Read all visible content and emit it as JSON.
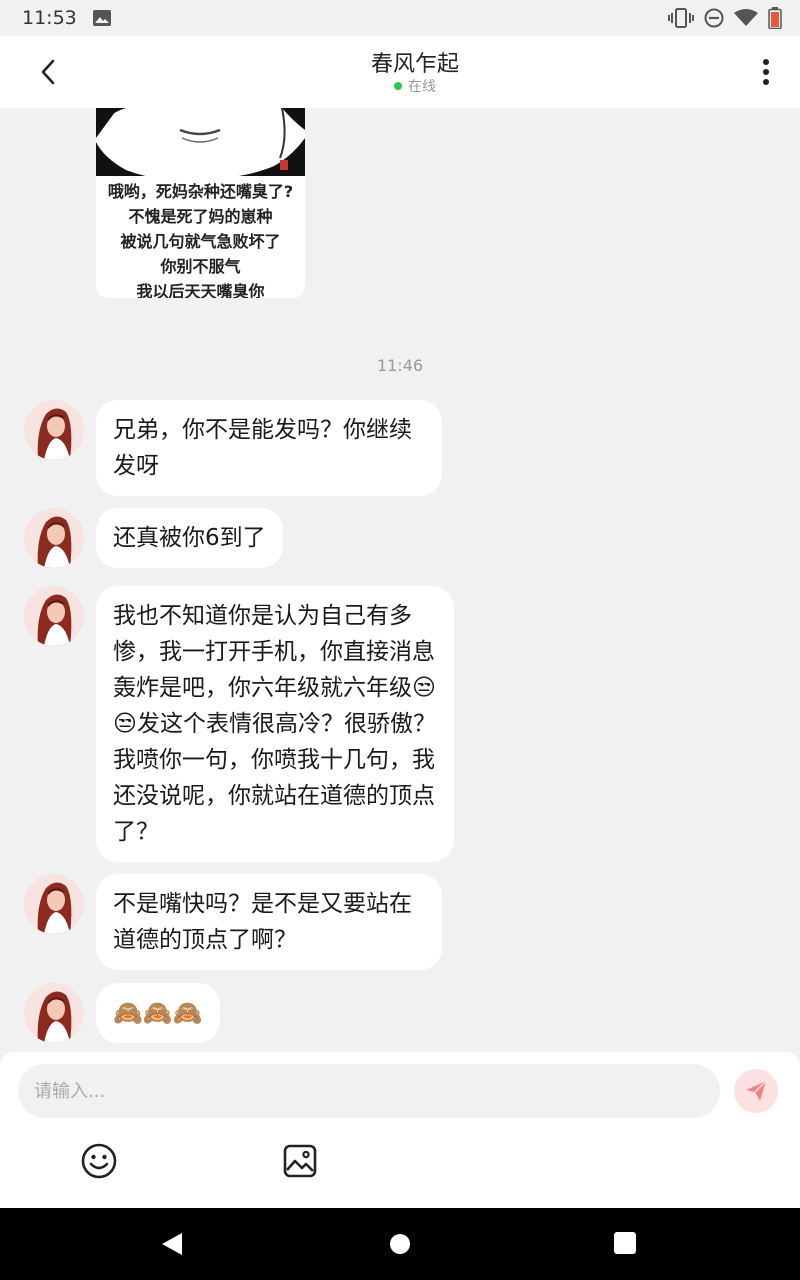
{
  "status_bar": {
    "time": "11:53",
    "icons": [
      "image-notification-icon",
      "vibrate-icon",
      "do-not-disturb-icon",
      "wifi-icon",
      "battery-icon"
    ]
  },
  "header": {
    "back_icon": "chevron-left-icon",
    "contact_name": "春风乍起",
    "presence": "在线",
    "presence_color": "#35c24a",
    "more_icon": "more-vertical-icon"
  },
  "meme": {
    "lines": [
      "哦哟，死妈杂种还嘴臭了?",
      "不愧是死了妈的崽种",
      "被说几句就气急败坏了",
      "你别不服气",
      "我以后天天嘴臭你"
    ]
  },
  "timestamp": "11:46",
  "messages": [
    {
      "text": "兄弟，你不是能发吗？你继续发呀"
    },
    {
      "text": "还真被你6到了"
    },
    {
      "text": "我也不知道你是认为自己有多惨，我一打开手机，你直接消息轰炸是吧，你六年级就六年级😒😒发这个表情很高冷？很骄傲？我喷你一句，你喷我十几句，我还没说呢，你就站在道德的顶点了？"
    },
    {
      "text": "不是嘴快吗？是不是又要站在道德的顶点了啊？"
    },
    {
      "text": "🙈🙈🙈"
    }
  ],
  "input": {
    "placeholder": "请输入...",
    "value": ""
  },
  "toolbar": {
    "send_icon": "send-icon",
    "emoji_icon": "emoji-icon",
    "image_icon": "image-icon"
  },
  "colors": {
    "background": "#f1f1f1",
    "bubble": "#ffffff",
    "send_button": "#fbe1e1",
    "send_icon": "#f08585"
  }
}
